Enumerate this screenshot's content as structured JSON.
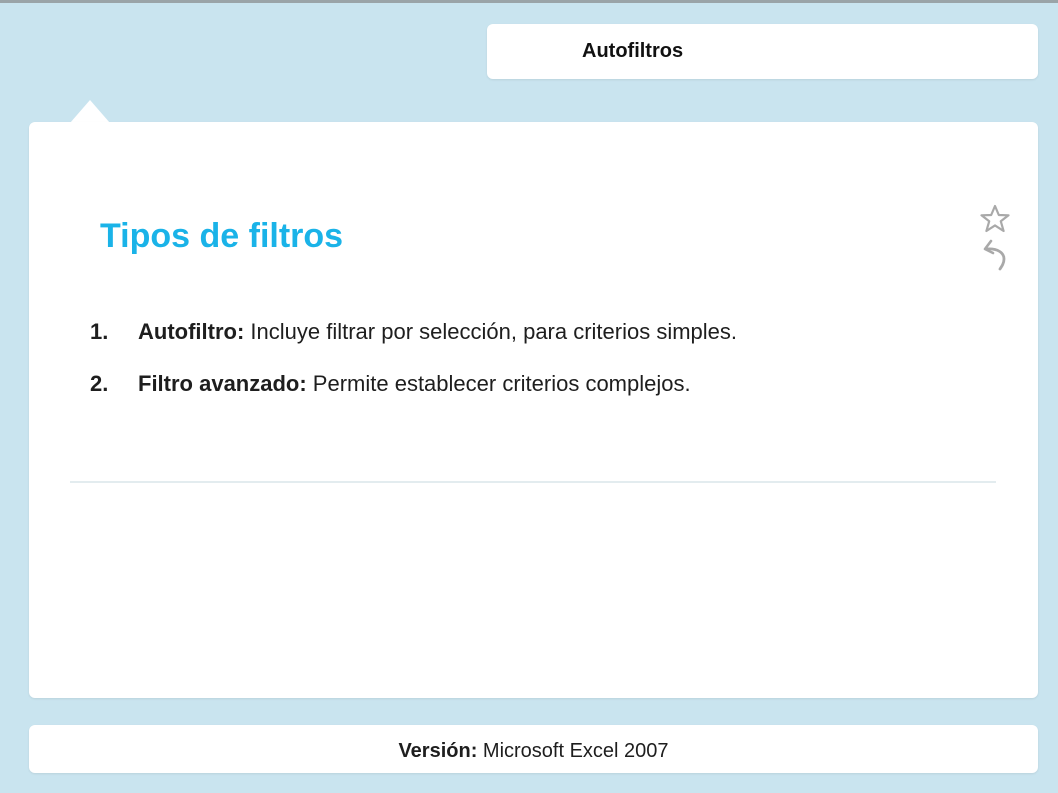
{
  "header": {
    "title": "Autofiltros"
  },
  "slide": {
    "title": "Tipos de filtros",
    "items": [
      {
        "number": "1.",
        "term": "Autofiltro:",
        "description": " Incluye filtrar por selección, para criterios simples."
      },
      {
        "number": "2.",
        "term": "Filtro avanzado:",
        "description": " Permite establecer criterios complejos."
      }
    ]
  },
  "icons": {
    "favorite": "star-icon",
    "back": "back-arrow-icon"
  },
  "footer": {
    "version_label": "Versión:",
    "version_value": " Microsoft Excel 2007"
  },
  "colors": {
    "background": "#c9e4ef",
    "title_accent": "#1ab3e8",
    "card": "#ffffff"
  }
}
